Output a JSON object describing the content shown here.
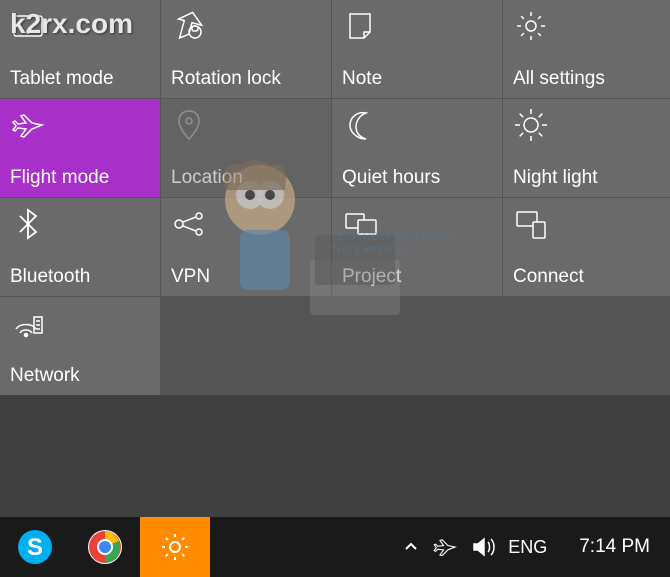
{
  "watermark": "k2rx.com",
  "tiles": [
    {
      "label": "Tablet mode",
      "icon": "tablet-icon",
      "active": false
    },
    {
      "label": "Rotation lock",
      "icon": "rotation-lock-icon",
      "active": false
    },
    {
      "label": "Note",
      "icon": "note-icon",
      "active": false
    },
    {
      "label": "All settings",
      "icon": "settings-icon",
      "active": false
    },
    {
      "label": "Flight mode",
      "icon": "airplane-icon",
      "active": true
    },
    {
      "label": "Location",
      "icon": "location-icon",
      "active": false,
      "dimmed": true
    },
    {
      "label": "Quiet hours",
      "icon": "moon-icon",
      "active": false
    },
    {
      "label": "Night light",
      "icon": "brightness-icon",
      "active": false
    },
    {
      "label": "Bluetooth",
      "icon": "bluetooth-icon",
      "active": false
    },
    {
      "label": "VPN",
      "icon": "vpn-icon",
      "active": false
    },
    {
      "label": "Project",
      "icon": "project-icon",
      "active": false
    },
    {
      "label": "Connect",
      "icon": "connect-icon",
      "active": false
    },
    {
      "label": "Network",
      "icon": "network-icon",
      "active": false
    },
    {
      "label": "",
      "icon": "",
      "active": false
    },
    {
      "label": "",
      "icon": "",
      "active": false
    },
    {
      "label": "",
      "icon": "",
      "active": false
    }
  ],
  "taskbar": {
    "apps": [
      {
        "name": "skype",
        "color": "#00aff0"
      },
      {
        "name": "chrome",
        "colors": [
          "#ea4335",
          "#fbbc05",
          "#34a853",
          "#4285f4"
        ]
      },
      {
        "name": "settings",
        "active": true
      }
    ],
    "tray": {
      "chevron": "^",
      "airplane": true,
      "volume": true,
      "language": "ENG",
      "time": "7:14 PM"
    }
  }
}
